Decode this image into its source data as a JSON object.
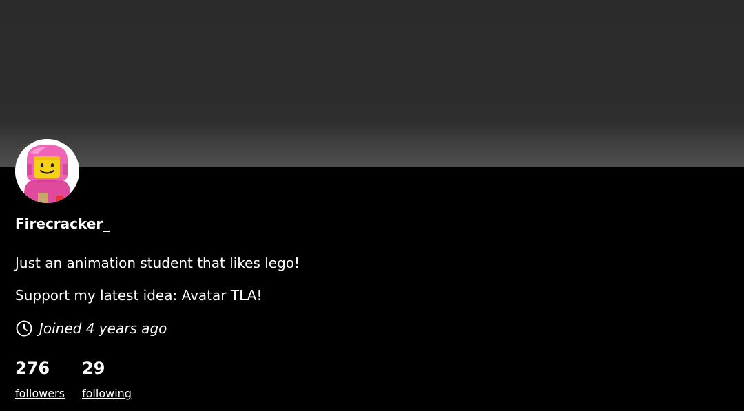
{
  "profile": {
    "username": "Firecracker_",
    "bio_lines": [
      "Just an animation student that likes lego!",
      "Support my latest idea: Avatar TLA!"
    ],
    "joined": "Joined 4 years ago",
    "avatar_icon": "pink-spaceman-minifigure-avatar",
    "joined_icon": "clock-icon"
  },
  "stats": {
    "followers": {
      "count": "276",
      "label": "followers"
    },
    "following": {
      "count": "29",
      "label": "following"
    }
  },
  "colors": {
    "background": "#000000",
    "banner": "#2d2d2d",
    "text": "#ffffff",
    "avatar_pink": "#e64fa5"
  }
}
